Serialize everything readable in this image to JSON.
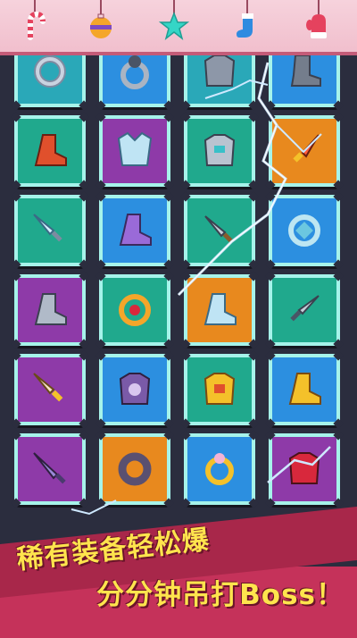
{
  "header": {
    "decorations": [
      {
        "name": "candy-cane-icon",
        "color": "#e5425e"
      },
      {
        "name": "ornament-ball-icon",
        "color": "#f4a62a"
      },
      {
        "name": "star-ornament-icon",
        "color": "#35d6c6"
      },
      {
        "name": "stocking-icon",
        "color": "#2f8be0"
      },
      {
        "name": "mitten-icon",
        "color": "#e5425e"
      }
    ]
  },
  "grid": {
    "rows": [
      [
        {
          "item": "ring-icon",
          "bg": "#2aa8b8"
        },
        {
          "item": "gem-ring-icon",
          "bg": "#2c8fe0"
        },
        {
          "item": "chest-armor-icon",
          "bg": "#2aa8b8"
        },
        {
          "item": "iron-boot-icon",
          "bg": "#2c8fe0"
        }
      ],
      [
        {
          "item": "red-boot-icon",
          "bg": "#20a98d"
        },
        {
          "item": "ice-armor-icon",
          "bg": "#8e3aa8"
        },
        {
          "item": "steel-armor-icon",
          "bg": "#20a98d"
        },
        {
          "item": "fire-dagger-icon",
          "bg": "#e8891e"
        }
      ],
      [
        {
          "item": "ice-dagger-icon",
          "bg": "#20a98d"
        },
        {
          "item": "purple-boot-icon",
          "bg": "#2c8fe0"
        },
        {
          "item": "short-sword-icon",
          "bg": "#20a98d"
        },
        {
          "item": "crystal-ring-icon",
          "bg": "#2c8fe0"
        }
      ],
      [
        {
          "item": "steel-boot-icon",
          "bg": "#8e3aa8"
        },
        {
          "item": "ruby-ring-icon",
          "bg": "#20a98d"
        },
        {
          "item": "ice-boot-icon",
          "bg": "#e8891e"
        },
        {
          "item": "broad-sword-icon",
          "bg": "#20a98d"
        }
      ],
      [
        {
          "item": "gold-dagger-icon",
          "bg": "#8e3aa8"
        },
        {
          "item": "skull-armor-icon",
          "bg": "#2c8fe0"
        },
        {
          "item": "gold-armor-icon",
          "bg": "#20a98d"
        },
        {
          "item": "gold-boot-icon",
          "bg": "#2c8fe0"
        }
      ],
      [
        {
          "item": "jagged-sword-icon",
          "bg": "#8e3aa8"
        },
        {
          "item": "dark-ring-icon",
          "bg": "#e8891e"
        },
        {
          "item": "gold-ring-icon",
          "bg": "#2c8fe0"
        },
        {
          "item": "dragon-armor-icon",
          "bg": "#8e3aa8"
        }
      ]
    ]
  },
  "banner": {
    "line1": "稀有装备轻松爆",
    "line2": "分分钟吊打Boss！"
  }
}
